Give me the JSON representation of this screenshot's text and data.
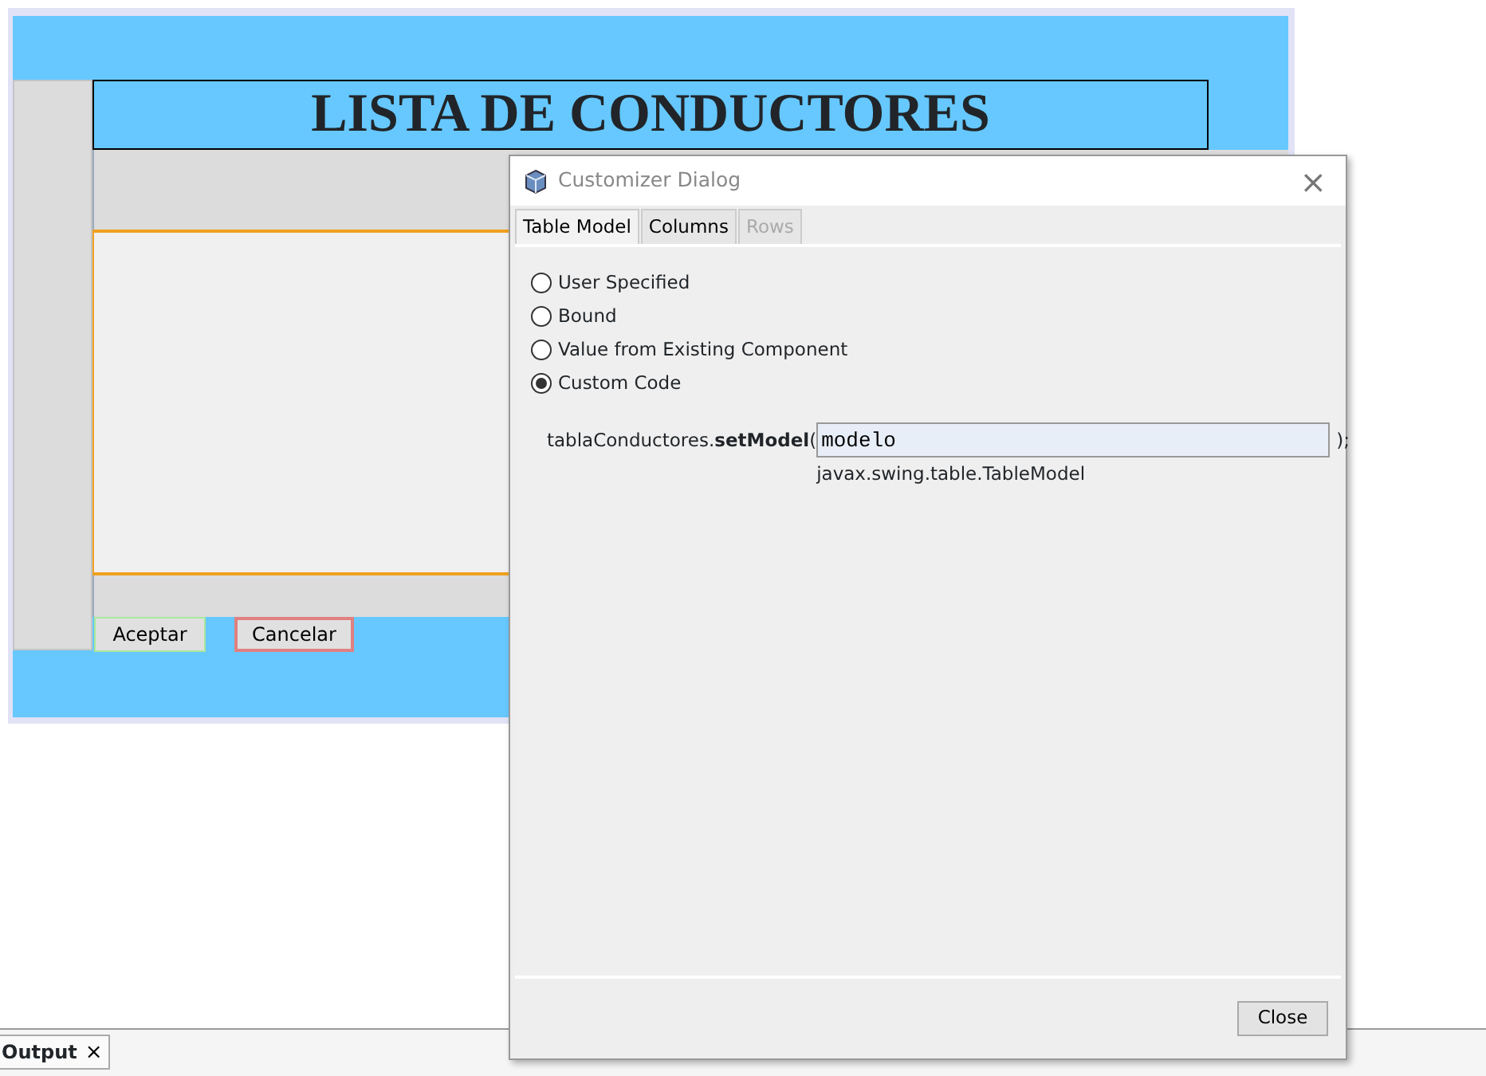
{
  "form": {
    "title": "LISTA DE CONDUCTORES",
    "buttons": [
      {
        "label": "Aceptar",
        "kind": "ok"
      },
      {
        "label": "Cancelar",
        "kind": "cancel"
      }
    ]
  },
  "dialog": {
    "title": "Customizer Dialog",
    "close": "×",
    "tabs": [
      {
        "label": "Table Model",
        "selected": true,
        "disabled": false
      },
      {
        "label": "Columns",
        "selected": false,
        "disabled": false
      },
      {
        "label": "Rows",
        "selected": false,
        "disabled": true
      }
    ],
    "options": [
      {
        "label": "User Specified",
        "selected": false
      },
      {
        "label": "Bound",
        "selected": false
      },
      {
        "label": "Value from Existing Component",
        "selected": false
      },
      {
        "label": "Custom Code",
        "selected": true
      }
    ],
    "code": {
      "prefix": "tablaConductores.**setModel**(",
      "value": "modelo",
      "suffix": ");",
      "type_hint": "javax.swing.table.TableModel"
    },
    "buttons": [
      "Close"
    ]
  },
  "output_tab": {
    "label": "Output",
    "close": "×"
  }
}
